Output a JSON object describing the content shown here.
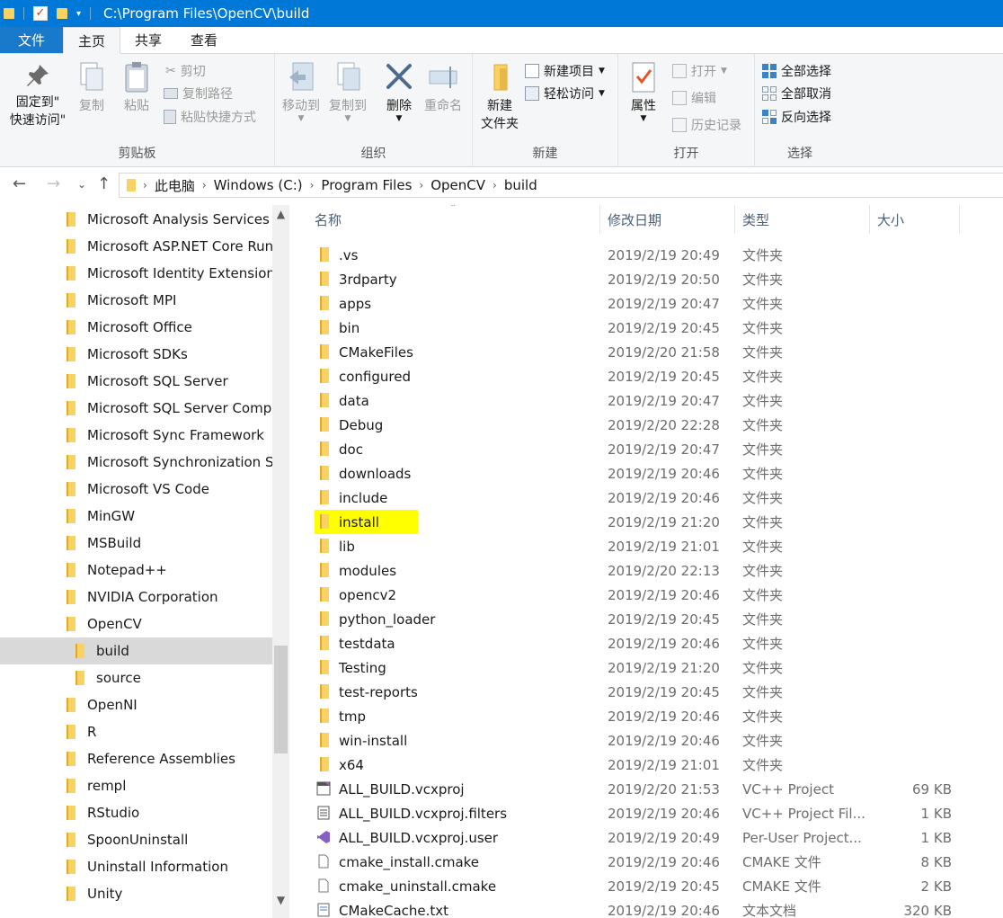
{
  "window": {
    "title_path": "C:\\Program Files\\OpenCV\\build"
  },
  "ribbon_tabs": {
    "file": "文件",
    "home": "主页",
    "share": "共享",
    "view": "查看"
  },
  "ribbon": {
    "clipboard": {
      "label": "剪贴板",
      "pin_line1": "固定到\"",
      "pin_line2": "快速访问\"",
      "copy": "复制",
      "paste": "粘贴",
      "cut": "剪切",
      "copy_path": "复制路径",
      "paste_shortcut": "粘贴快捷方式"
    },
    "organize": {
      "label": "组织",
      "move_to": "移动到",
      "copy_to": "复制到",
      "delete": "删除",
      "rename": "重命名"
    },
    "new": {
      "label": "新建",
      "new_folder_line1": "新建",
      "new_folder_line2": "文件夹",
      "new_item": "新建项目",
      "easy_access": "轻松访问"
    },
    "open": {
      "label": "打开",
      "properties": "属性",
      "open": "打开",
      "edit": "编辑",
      "history": "历史记录"
    },
    "select": {
      "label": "选择",
      "select_all": "全部选择",
      "select_none": "全部取消",
      "invert": "反向选择"
    }
  },
  "breadcrumb": [
    "此电脑",
    "Windows (C:)",
    "Program Files",
    "OpenCV",
    "build"
  ],
  "nav_items": [
    {
      "label": "Microsoft Analysis Services",
      "indent": 0
    },
    {
      "label": "Microsoft ASP.NET Core Run",
      "indent": 0
    },
    {
      "label": "Microsoft Identity Extensions",
      "indent": 0
    },
    {
      "label": "Microsoft MPI",
      "indent": 0
    },
    {
      "label": "Microsoft Office",
      "indent": 0
    },
    {
      "label": "Microsoft SDKs",
      "indent": 0
    },
    {
      "label": "Microsoft SQL Server",
      "indent": 0
    },
    {
      "label": "Microsoft SQL Server Compa",
      "indent": 0
    },
    {
      "label": "Microsoft Sync Framework",
      "indent": 0
    },
    {
      "label": "Microsoft Synchronization Se",
      "indent": 0
    },
    {
      "label": "Microsoft VS Code",
      "indent": 0
    },
    {
      "label": "MinGW",
      "indent": 0
    },
    {
      "label": "MSBuild",
      "indent": 0
    },
    {
      "label": "Notepad++",
      "indent": 0
    },
    {
      "label": "NVIDIA Corporation",
      "indent": 0
    },
    {
      "label": "OpenCV",
      "indent": 0
    },
    {
      "label": "build",
      "indent": 1,
      "selected": true
    },
    {
      "label": "source",
      "indent": 1
    },
    {
      "label": "OpenNI",
      "indent": 0
    },
    {
      "label": "R",
      "indent": 0
    },
    {
      "label": "Reference Assemblies",
      "indent": 0
    },
    {
      "label": "rempl",
      "indent": 0
    },
    {
      "label": "RStudio",
      "indent": 0
    },
    {
      "label": "SpoonUninstall",
      "indent": 0
    },
    {
      "label": "Uninstall Information",
      "indent": 0
    },
    {
      "label": "Unity",
      "indent": 0
    }
  ],
  "columns": {
    "name": "名称",
    "date": "修改日期",
    "type": "类型",
    "size": "大小"
  },
  "files": [
    {
      "name": ".vs",
      "date": "2019/2/19 20:49",
      "type": "文件夹",
      "size": "",
      "icon": "folder"
    },
    {
      "name": "3rdparty",
      "date": "2019/2/19 20:50",
      "type": "文件夹",
      "size": "",
      "icon": "folder"
    },
    {
      "name": "apps",
      "date": "2019/2/19 20:47",
      "type": "文件夹",
      "size": "",
      "icon": "folder"
    },
    {
      "name": "bin",
      "date": "2019/2/19 20:45",
      "type": "文件夹",
      "size": "",
      "icon": "folder"
    },
    {
      "name": "CMakeFiles",
      "date": "2019/2/20 21:58",
      "type": "文件夹",
      "size": "",
      "icon": "folder"
    },
    {
      "name": "configured",
      "date": "2019/2/19 20:45",
      "type": "文件夹",
      "size": "",
      "icon": "folder"
    },
    {
      "name": "data",
      "date": "2019/2/19 20:47",
      "type": "文件夹",
      "size": "",
      "icon": "folder"
    },
    {
      "name": "Debug",
      "date": "2019/2/20 22:28",
      "type": "文件夹",
      "size": "",
      "icon": "folder"
    },
    {
      "name": "doc",
      "date": "2019/2/19 20:47",
      "type": "文件夹",
      "size": "",
      "icon": "folder"
    },
    {
      "name": "downloads",
      "date": "2019/2/19 20:46",
      "type": "文件夹",
      "size": "",
      "icon": "folder"
    },
    {
      "name": "include",
      "date": "2019/2/19 20:46",
      "type": "文件夹",
      "size": "",
      "icon": "folder"
    },
    {
      "name": "install",
      "date": "2019/2/19 21:20",
      "type": "文件夹",
      "size": "",
      "icon": "folder",
      "highlighted": true
    },
    {
      "name": "lib",
      "date": "2019/2/19 21:01",
      "type": "文件夹",
      "size": "",
      "icon": "folder"
    },
    {
      "name": "modules",
      "date": "2019/2/20 22:13",
      "type": "文件夹",
      "size": "",
      "icon": "folder"
    },
    {
      "name": "opencv2",
      "date": "2019/2/19 20:46",
      "type": "文件夹",
      "size": "",
      "icon": "folder"
    },
    {
      "name": "python_loader",
      "date": "2019/2/19 20:45",
      "type": "文件夹",
      "size": "",
      "icon": "folder"
    },
    {
      "name": "testdata",
      "date": "2019/2/19 20:46",
      "type": "文件夹",
      "size": "",
      "icon": "folder"
    },
    {
      "name": "Testing",
      "date": "2019/2/19 21:20",
      "type": "文件夹",
      "size": "",
      "icon": "folder"
    },
    {
      "name": "test-reports",
      "date": "2019/2/19 20:45",
      "type": "文件夹",
      "size": "",
      "icon": "folder"
    },
    {
      "name": "tmp",
      "date": "2019/2/19 20:46",
      "type": "文件夹",
      "size": "",
      "icon": "folder"
    },
    {
      "name": "win-install",
      "date": "2019/2/19 20:46",
      "type": "文件夹",
      "size": "",
      "icon": "folder"
    },
    {
      "name": "x64",
      "date": "2019/2/19 21:01",
      "type": "文件夹",
      "size": "",
      "icon": "folder"
    },
    {
      "name": "ALL_BUILD.vcxproj",
      "date": "2019/2/20 21:53",
      "type": "VC++ Project",
      "size": "69 KB",
      "icon": "vcxproj"
    },
    {
      "name": "ALL_BUILD.vcxproj.filters",
      "date": "2019/2/19 20:46",
      "type": "VC++ Project Fil...",
      "size": "1 KB",
      "icon": "filters"
    },
    {
      "name": "ALL_BUILD.vcxproj.user",
      "date": "2019/2/19 20:49",
      "type": "Per-User Project...",
      "size": "1 KB",
      "icon": "vsuser"
    },
    {
      "name": "cmake_install.cmake",
      "date": "2019/2/19 20:46",
      "type": "CMAKE 文件",
      "size": "8 KB",
      "icon": "file"
    },
    {
      "name": "cmake_uninstall.cmake",
      "date": "2019/2/19 20:45",
      "type": "CMAKE 文件",
      "size": "2 KB",
      "icon": "file"
    },
    {
      "name": "CMakeCache.txt",
      "date": "2019/2/19 20:46",
      "type": "文本文档",
      "size": "320 KB",
      "icon": "txt"
    }
  ],
  "colors": {
    "titlebar": "#0078d7",
    "folder": "#f8d263",
    "highlight": "#ffff00",
    "selected_nav": "#d9d9d9"
  }
}
